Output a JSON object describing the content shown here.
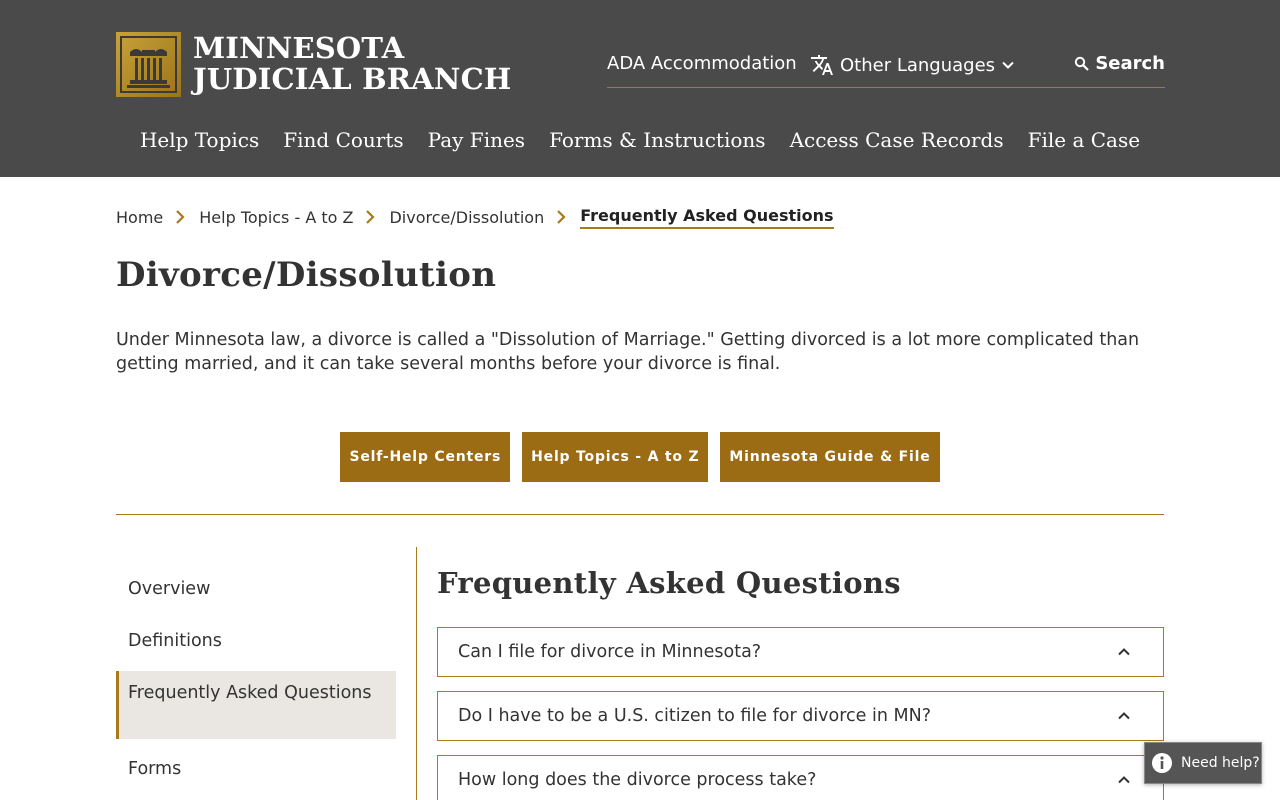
{
  "header": {
    "logo_line1": "MINNESOTA",
    "logo_line2": "JUDICIAL BRANCH",
    "utility": {
      "ada": "ADA Accommodation",
      "languages": "Other Languages",
      "search": "Search"
    },
    "nav": [
      "Help Topics",
      "Find Courts",
      "Pay Fines",
      "Forms & Instructions",
      "Access Case Records",
      "File a Case"
    ]
  },
  "breadcrumb": [
    "Home",
    "Help Topics - A to Z",
    "Divorce/Dissolution",
    "Frequently Asked Questions"
  ],
  "page": {
    "title": "Divorce/Dissolution",
    "intro": "Under Minnesota law, a divorce is called a \"Dissolution of Marriage.\"  Getting divorced is a lot more complicated than getting married, and it can take several months before your divorce is final."
  },
  "buttons": [
    "Self-Help Centers",
    "Help Topics - A to Z",
    "Minnesota Guide & File"
  ],
  "sidenav": [
    "Overview",
    "Definitions",
    "Frequently Asked Questions",
    "Forms"
  ],
  "faq": {
    "title": "Frequently Asked Questions",
    "questions": [
      "Can I file for divorce in Minnesota?",
      "Do I have to be a U.S. citizen to file for divorce in MN?",
      "How long does the divorce process take?"
    ]
  },
  "help_widget": "Need help?",
  "colors": {
    "header_bg": "#4a4a4a",
    "accent_gold": "#a87b1a",
    "button_bg": "#9b6c14",
    "active_nav_bg": "#eae7e3"
  }
}
